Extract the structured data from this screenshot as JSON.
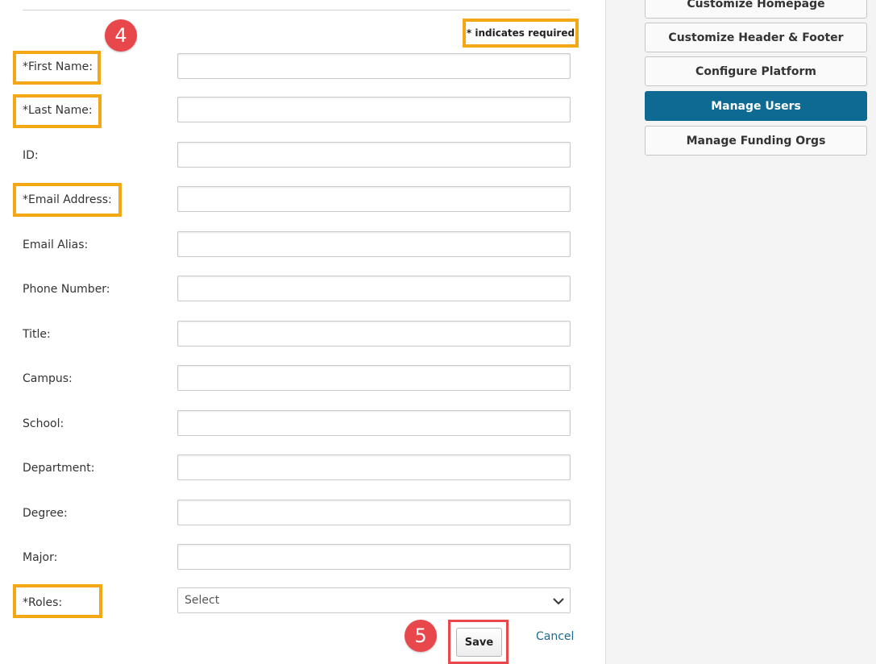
{
  "form": {
    "required_note": "* indicates required",
    "step_four": "4",
    "step_five": "5",
    "fields": {
      "first_name": "*First Name:",
      "last_name": "*Last Name:",
      "id": "ID:",
      "email": "*Email Address:",
      "email_alias": "Email Alias:",
      "phone": "Phone Number:",
      "title": "Title:",
      "campus": "Campus:",
      "school": "School:",
      "department": "Department:",
      "degree": "Degree:",
      "major": "Major:",
      "roles": "*Roles:"
    },
    "roles_select": {
      "value": "Select",
      "options": [
        "Select"
      ]
    },
    "save_label": "Save",
    "cancel_label": "Cancel"
  },
  "sidebar": {
    "items": [
      {
        "label": "Customize Homepage",
        "active": false
      },
      {
        "label": "Customize Header & Footer",
        "active": false
      },
      {
        "label": "Configure Platform",
        "active": false
      },
      {
        "label": "Manage Users",
        "active": true
      },
      {
        "label": "Manage Funding Orgs",
        "active": false
      }
    ]
  },
  "colors": {
    "highlight_orange": "#f3a712",
    "badge_red": "#e8474b",
    "active_blue": "#0e6a92",
    "link_blue": "#1d6a8e"
  }
}
